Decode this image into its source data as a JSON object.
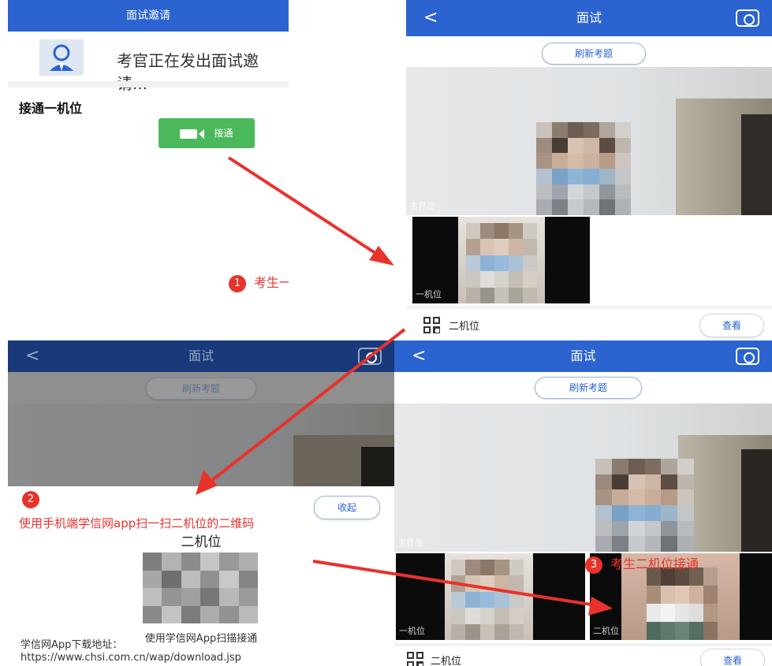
{
  "panel1": {
    "title": "面试邀请",
    "invite_text": "考官正在发出面试邀请...",
    "section_title": "接通一机位",
    "connect_label": "接通",
    "annotation_num": "1",
    "annotation_text": "考生一机位接通"
  },
  "panel2": {
    "back": "<",
    "title": "面试",
    "refresh_label": "刷新考题",
    "main_video_label": "主界面",
    "sub_video_label": "一机位",
    "row_label": "二机位",
    "view_label": "查看"
  },
  "panel3": {
    "back": "<",
    "title": "面试",
    "refresh_label": "刷新考题",
    "annotation_num": "2",
    "collapse_label": "收起",
    "annotation_text": "使用手机端学信网app扫一扫二机位的二维码",
    "qr_title": "二机位",
    "qr_hint": "使用学信网App扫描接通",
    "download_label": "学信网App下载地址：",
    "download_url": "https://www.chsi.com.cn/wap/download.jsp"
  },
  "panel4": {
    "back": "<",
    "title": "面试",
    "refresh_label": "刷新考题",
    "main_video_label": "主界面",
    "sub1_label": "一机位",
    "sub2_label": "二机位",
    "annotation_num": "3",
    "annotation_text": "考生二机位接通",
    "row_label": "二机位",
    "view_label": "查看"
  },
  "colors": {
    "header_blue": "#2b63d1",
    "connect_green": "#4cb85c",
    "annotation_red": "#e8322c"
  }
}
